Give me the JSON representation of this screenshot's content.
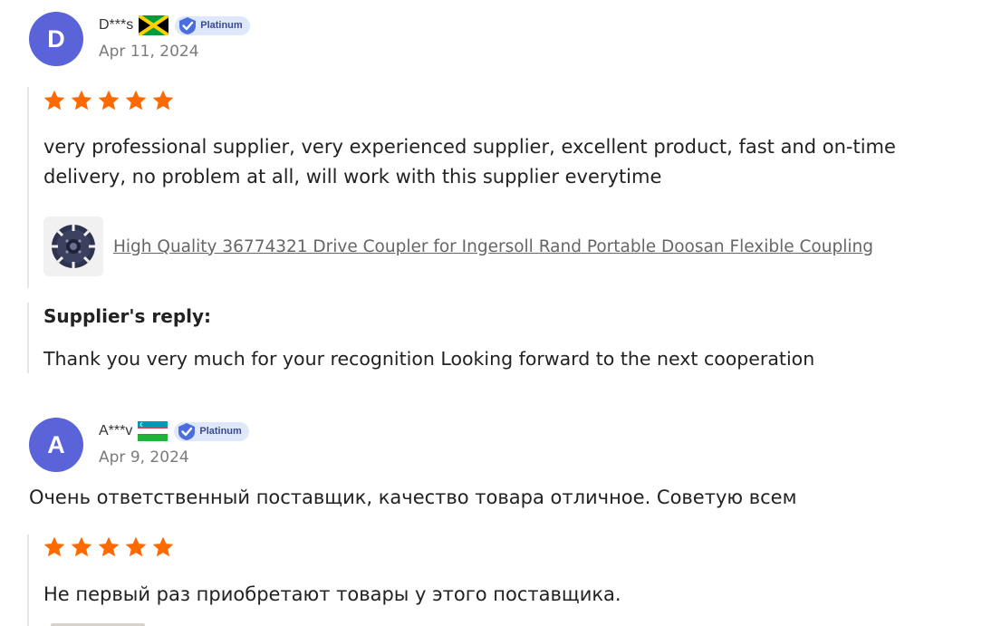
{
  "reviews": [
    {
      "avatar_letter": "D",
      "name": "D***s",
      "flag_icon": "jamaica-flag-icon",
      "badge": "Platinum",
      "date": "Apr 11, 2024",
      "rating": 5,
      "text": "very professional supplier, very experienced supplier, excellent product, fast and on-time delivery, no problem at all, will work with this supplier everytime",
      "product_link": "High Quality 36774321 Drive Coupler for Ingersoll Rand Portable Doosan Flexible Coupling",
      "reply_title": "Supplier's reply:",
      "reply_text": "Thank you very much for your recognition Looking forward to the next cooperation"
    },
    {
      "avatar_letter": "A",
      "name": "A***v",
      "flag_icon": "uzbekistan-flag-icon",
      "badge": "Platinum",
      "date": "Apr 9, 2024",
      "summary": "Очень ответственный поставщик, качество товара отличное. Советую всем",
      "rating": 5,
      "text": "Не первый раз приобретают товары у этого поставщика."
    }
  ],
  "colors": {
    "avatar": "#5b63d8",
    "star": "#ff6a00",
    "badge_bg": "#dfe7fb",
    "badge_icon": "#4a6ee0"
  }
}
